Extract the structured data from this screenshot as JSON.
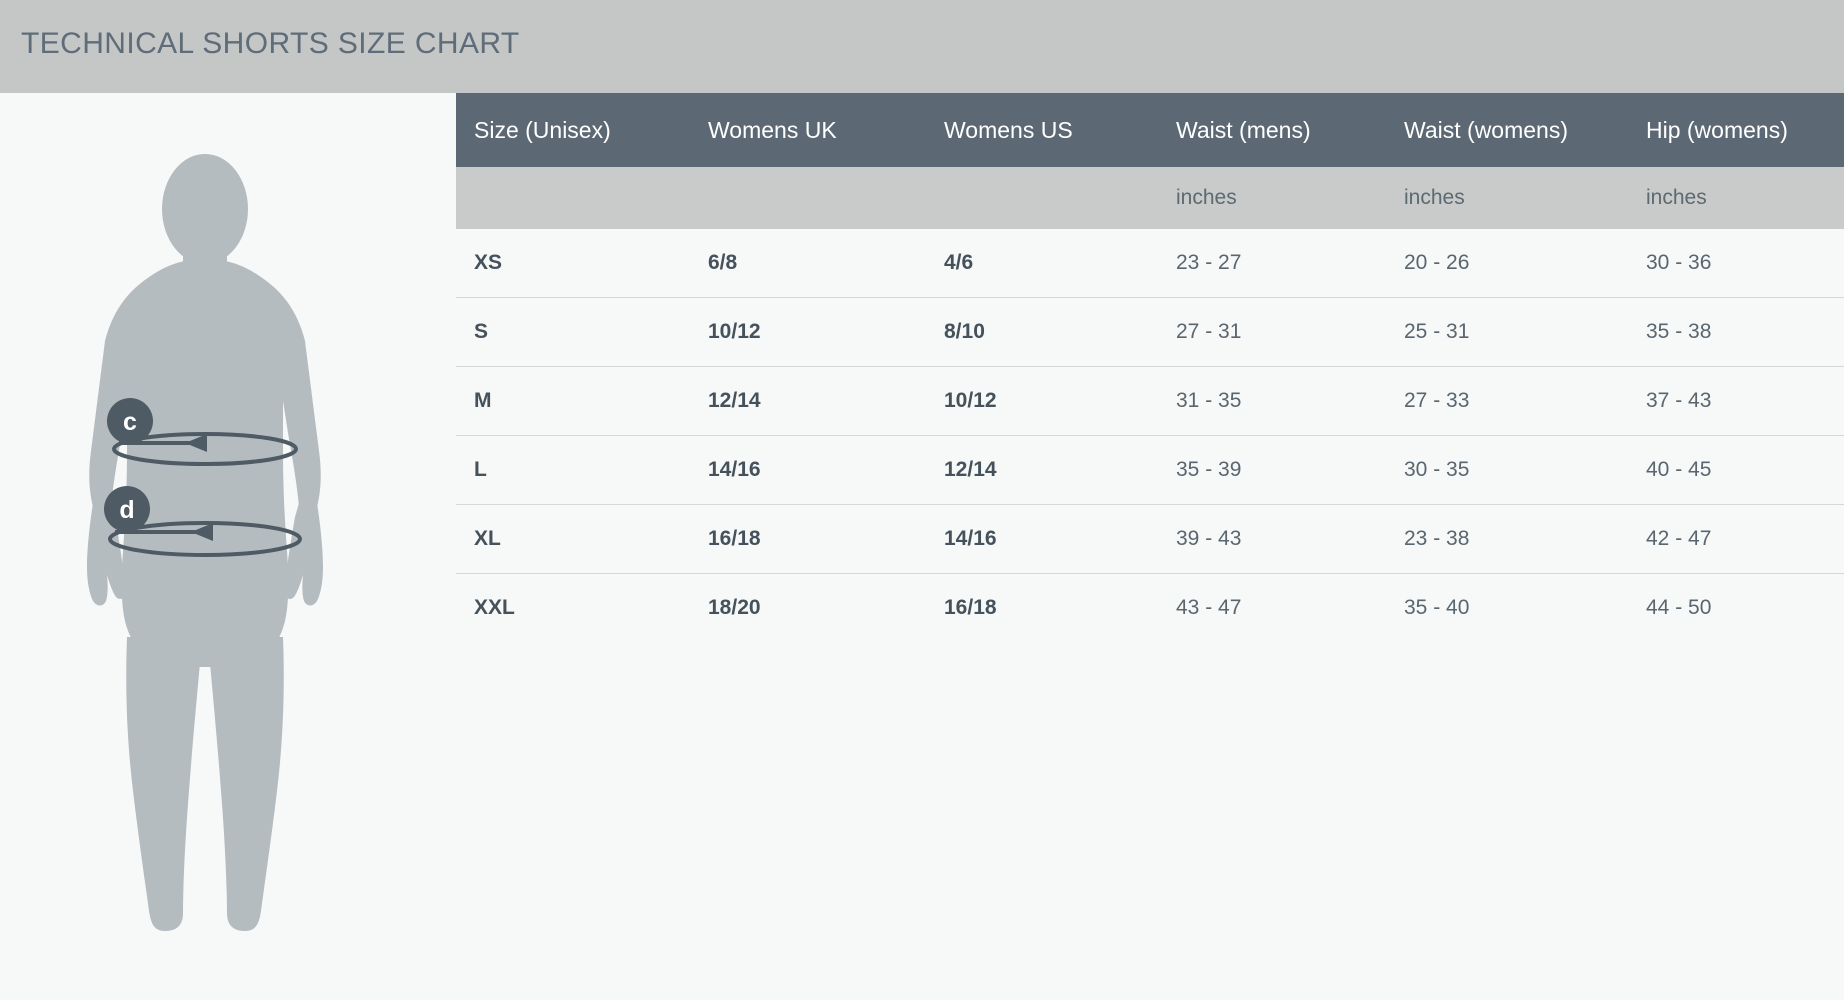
{
  "title": "TECHNICAL SHORTS SIZE CHART",
  "colors": {
    "title_bar_bg": "#c5c7c7",
    "title_text": "#5f6c79",
    "page_bg": "#f7f8f8",
    "header_bg": "#5c6873",
    "header_text": "#ffffff",
    "subheader_bg": "#c9cbcb",
    "subheader_text": "#5d6a6f",
    "row_text": "#4d5a63",
    "row_divider": "#d5d7d8",
    "figure_fill": "#b4bcc0",
    "marker_fill": "#4e5a64",
    "marker_text": "#ffffff",
    "measure_ring": "#4e5a64"
  },
  "figure": {
    "name": "body-silhouette",
    "markers": [
      {
        "id": "c",
        "label": "c",
        "meaning": "waist"
      },
      {
        "id": "d",
        "label": "d",
        "meaning": "hip"
      }
    ]
  },
  "table": {
    "columns": [
      {
        "key": "size",
        "label": "Size (Unisex)",
        "unit": ""
      },
      {
        "key": "womens_uk",
        "label": "Womens UK",
        "unit": ""
      },
      {
        "key": "womens_us",
        "label": "Womens US",
        "unit": ""
      },
      {
        "key": "waist_mens",
        "label": "Waist (mens)",
        "unit": "inches"
      },
      {
        "key": "waist_womens",
        "label": "Waist (womens)",
        "unit": "inches"
      },
      {
        "key": "hip_womens",
        "label": "Hip (womens)",
        "unit": "inches"
      }
    ],
    "rows": [
      {
        "size": "XS",
        "womens_uk": "6/8",
        "womens_us": "4/6",
        "waist_mens": "23 - 27",
        "waist_womens": "20 - 26",
        "hip_womens": "30 - 36"
      },
      {
        "size": "S",
        "womens_uk": "10/12",
        "womens_us": "8/10",
        "waist_mens": "27 - 31",
        "waist_womens": "25 - 31",
        "hip_womens": "35 - 38"
      },
      {
        "size": "M",
        "womens_uk": "12/14",
        "womens_us": "10/12",
        "waist_mens": "31 - 35",
        "waist_womens": "27 - 33",
        "hip_womens": "37 - 43"
      },
      {
        "size": "L",
        "womens_uk": "14/16",
        "womens_us": "12/14",
        "waist_mens": "35 - 39",
        "waist_womens": "30 - 35",
        "hip_womens": "40 - 45"
      },
      {
        "size": "XL",
        "womens_uk": "16/18",
        "womens_us": "14/16",
        "waist_mens": "39 - 43",
        "waist_womens": "23 - 38",
        "hip_womens": "42 - 47"
      },
      {
        "size": "XXL",
        "womens_uk": "18/20",
        "womens_us": "16/18",
        "waist_mens": "43 - 47",
        "waist_womens": "35 - 40",
        "hip_womens": "44 - 50"
      }
    ]
  }
}
